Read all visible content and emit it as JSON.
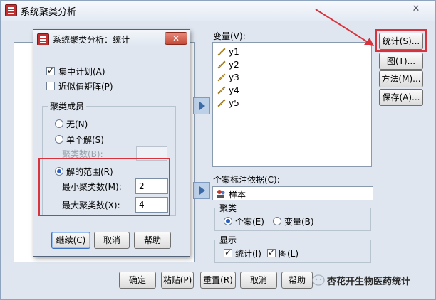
{
  "main_window": {
    "title": "系统聚类分析",
    "close": "✕",
    "variables_label": "变量(V):",
    "variables": [
      "y1",
      "y2",
      "y3",
      "y4",
      "y5"
    ],
    "side_buttons": [
      "统计(S)...",
      "图(T)...",
      "方法(M)...",
      "保存(A)..."
    ],
    "case_label": "个案标注依据(C):",
    "case_value": "样本",
    "cluster_group": "聚类",
    "cluster_options": [
      "个案(E)",
      "变量(B)"
    ],
    "cluster_selected": "个案(E)",
    "display_group": "显示",
    "display_options": [
      "统计(I)",
      "图(L)"
    ],
    "bottom_buttons": [
      "确定",
      "粘贴(P)",
      "重置(R)",
      "取消",
      "帮助"
    ]
  },
  "stats_dialog": {
    "title": "系统聚类分析：统计",
    "close": "✕",
    "agglomeration_schedule": "集中计划(A)",
    "agglomeration_checked": true,
    "proximity_matrix": "近似值矩阵(P)",
    "proximity_checked": false,
    "membership_group": "聚类成员",
    "none_option": "无(N)",
    "single_option": "单个解(S)",
    "num_clusters_label": "聚类数(B):",
    "range_option": "解的范围(R)",
    "range_selected": true,
    "min_label": "最小聚类数(M):",
    "min_value": "2",
    "max_label": "最大聚类数(X):",
    "max_value": "4",
    "continue": "继续(C)",
    "cancel": "取消",
    "help": "帮助"
  },
  "watermark": "杏花开生物医药统计",
  "colors": {
    "highlight_red": "#d8333d",
    "window_bg": "#dfe6ef"
  }
}
